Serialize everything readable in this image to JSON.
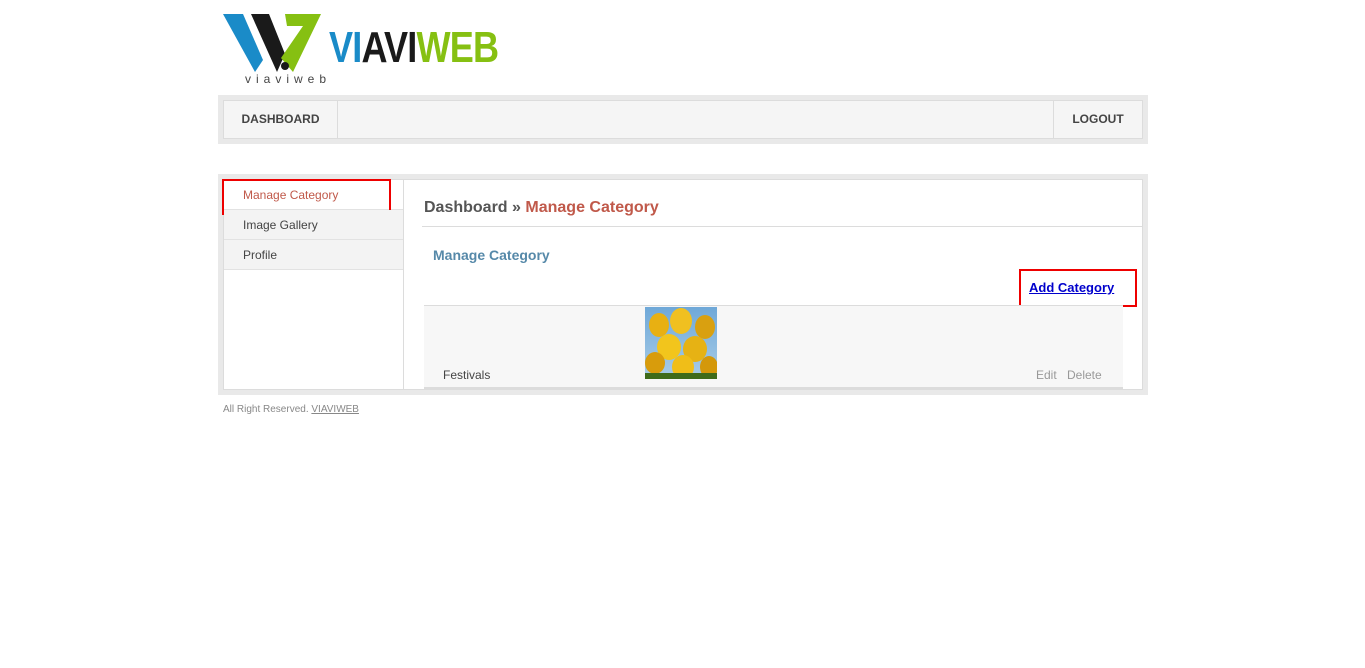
{
  "logo": {
    "word_vi": "VI",
    "word_avi": "AVI",
    "word_web": "WEB",
    "subtitle": "viaviweb",
    "colors": {
      "blue": "#1a8bc8",
      "black": "#1a1a1a",
      "green": "#86c012"
    }
  },
  "nav": {
    "dashboard": "DASHBOARD",
    "logout": "LOGOUT"
  },
  "sidebar": {
    "items": [
      {
        "label": "Manage Category",
        "active": true
      },
      {
        "label": "Image Gallery",
        "active": false
      },
      {
        "label": "Profile",
        "active": false
      }
    ]
  },
  "content": {
    "breadcrumb_root": "Dashboard",
    "breadcrumb_sep": "»",
    "breadcrumb_current": "Manage Category",
    "section_title": "Manage Category",
    "add_link": "Add Category",
    "rows": [
      {
        "name": "Festivals",
        "image": "yellow-tulips-photo",
        "edit": "Edit",
        "delete": "Delete"
      }
    ]
  },
  "footer": {
    "text": "All Right Reserved.",
    "link": "VIAVIWEB"
  },
  "colors": {
    "accent_red": "#c0594a",
    "link_blue": "#0000cc",
    "subtitle_blue": "#5689a9",
    "highlight": "#ee0000"
  }
}
